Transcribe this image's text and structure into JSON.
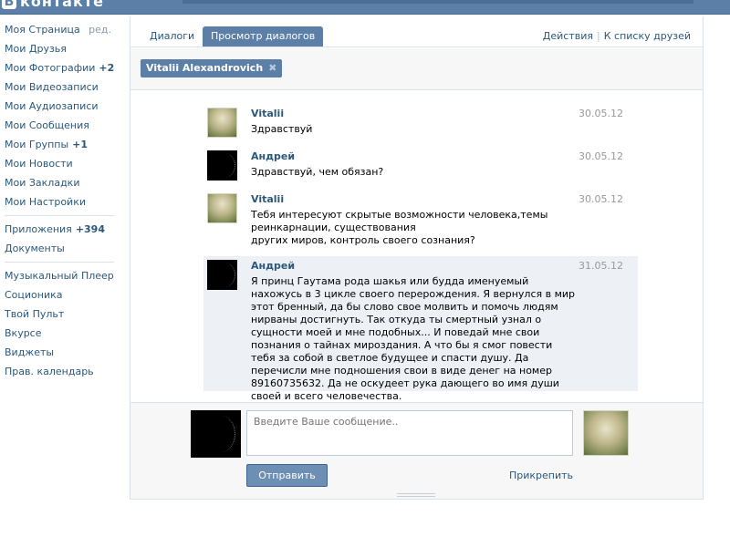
{
  "app": {
    "logo_letter": "В",
    "logo_text": "контакте"
  },
  "leftnav": {
    "items": [
      {
        "label": "Моя Страница",
        "extra": "ред."
      },
      {
        "label": "Мои Друзья"
      },
      {
        "label": "Мои Фотографии",
        "count": "+2"
      },
      {
        "label": "Мои Видеозаписи"
      },
      {
        "label": "Мои Аудиозаписи"
      },
      {
        "label": "Мои Сообщения"
      },
      {
        "label": "Мои Группы",
        "count": "+1"
      },
      {
        "label": "Мои Новости"
      },
      {
        "label": "Мои Закладки"
      },
      {
        "label": "Мои Настройки"
      }
    ],
    "apps": [
      {
        "label": "Приложения",
        "count": "+394"
      },
      {
        "label": "Документы"
      }
    ],
    "widgets": [
      {
        "label": "Музыкальный Плеер"
      },
      {
        "label": "Соционика"
      },
      {
        "label": "Твой Пульт"
      },
      {
        "label": "Вкурсе"
      },
      {
        "label": "Виджеты"
      },
      {
        "label": "Прав. календарь"
      }
    ]
  },
  "tabs": {
    "dialogs": "Диалоги",
    "view": "Просмотр диалогов",
    "actions": "Действия",
    "sep": "|",
    "friends_list": "К списку друзей"
  },
  "filter": {
    "chip_name": "Vitalii Alexandrovich",
    "chip_close": "✖"
  },
  "messages": [
    {
      "author": "Vitalii",
      "date": "30.05.12",
      "text": "Здравствуй"
    },
    {
      "author": "Андрей",
      "date": "30.05.12",
      "text": "Здравствуй, чем обязан?"
    },
    {
      "author": "Vitalii",
      "date": "30.05.12",
      "text": "Тебя интересуют скрытые возможности человека,темы\nреинкарнации, существования\nдругих миров, контроль своего сознания?"
    },
    {
      "author": "Андрей",
      "date": "31.05.12",
      "text": "Я принц Гаутама рода шакья или будда именуемый нахожусь в 3 цикле своего перерождения. Я вернулся в мир этот бренный, да бы слово свое молвить и помочь людям нирваны достигнуть. Так откуда ты смертный узнал о сущности моей и мне подобных... И поведай мне свои познания о тайнах мироздания. А что бы я смог повести тебя за собой в светлое будущее и спасти душу. Да перечисли мне подношения свои в виде денег на номер 89160735632. Да не оскудеет рука дающего во имя души своей и всего человечества."
    }
  ],
  "composer": {
    "placeholder": "Введите Ваше сообщение..",
    "send_label": "Отправить",
    "attach_label": "Прикрепить"
  }
}
